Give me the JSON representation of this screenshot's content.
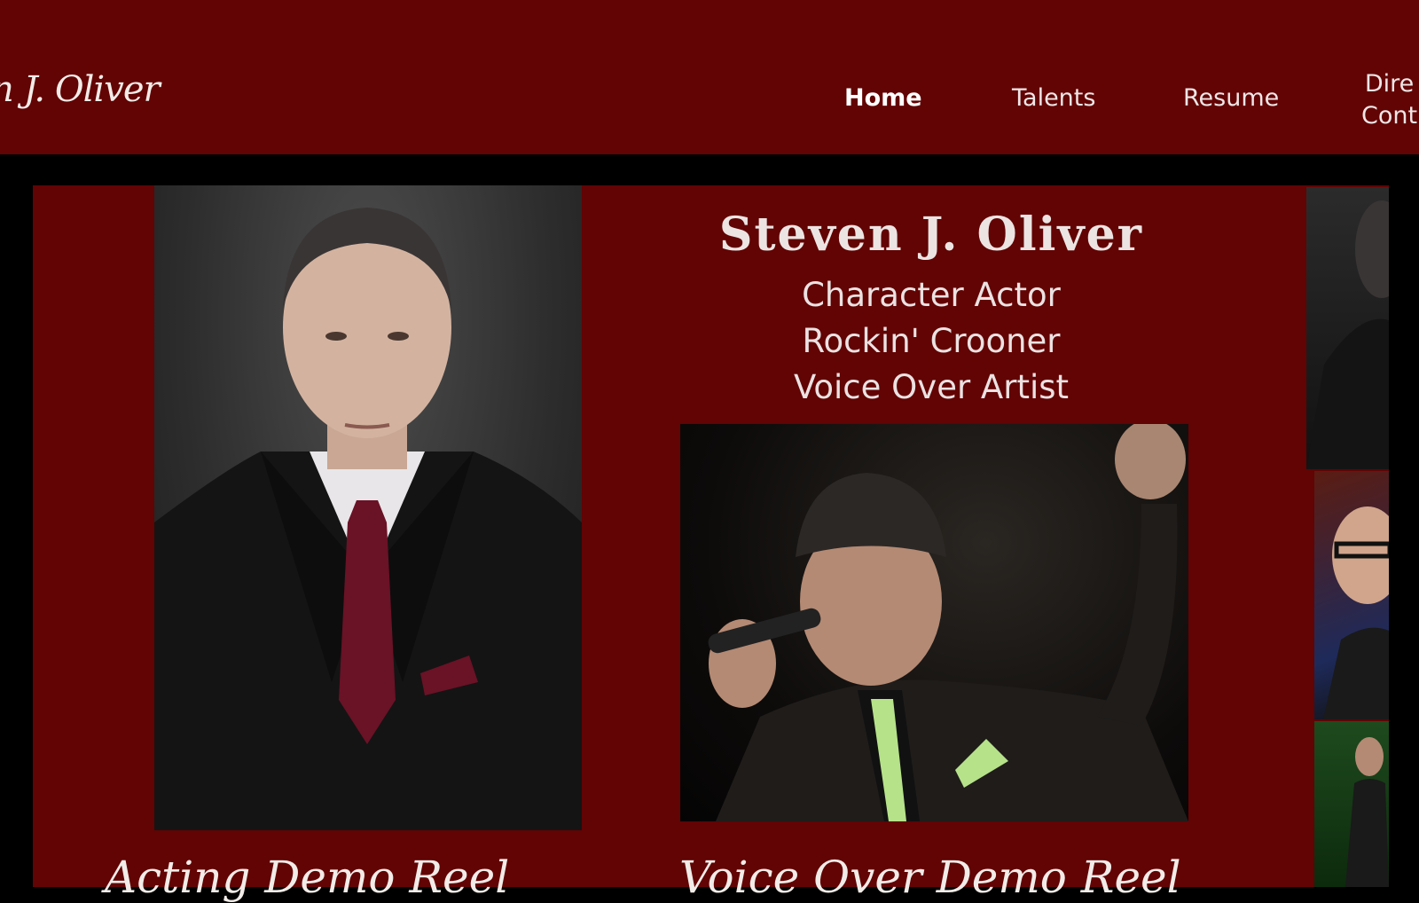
{
  "header": {
    "logo_text": "n J. Oliver",
    "nav": {
      "home": "Home",
      "talents": "Talents",
      "resume": "Resume",
      "direct_line1": "Dire",
      "direct_line2": "Cont"
    }
  },
  "hero": {
    "name": "Steven J. Oliver",
    "taglines": [
      "Character Actor",
      "Rockin' Crooner",
      "Voice Over Artist"
    ]
  },
  "reels": {
    "acting": "Acting Demo Reel",
    "voice_over": "Voice Over Demo Reel"
  },
  "colors": {
    "header_bg": "#620304",
    "panel_bg": "#620304",
    "page_bg": "#000000",
    "text": "#ece4e2"
  }
}
